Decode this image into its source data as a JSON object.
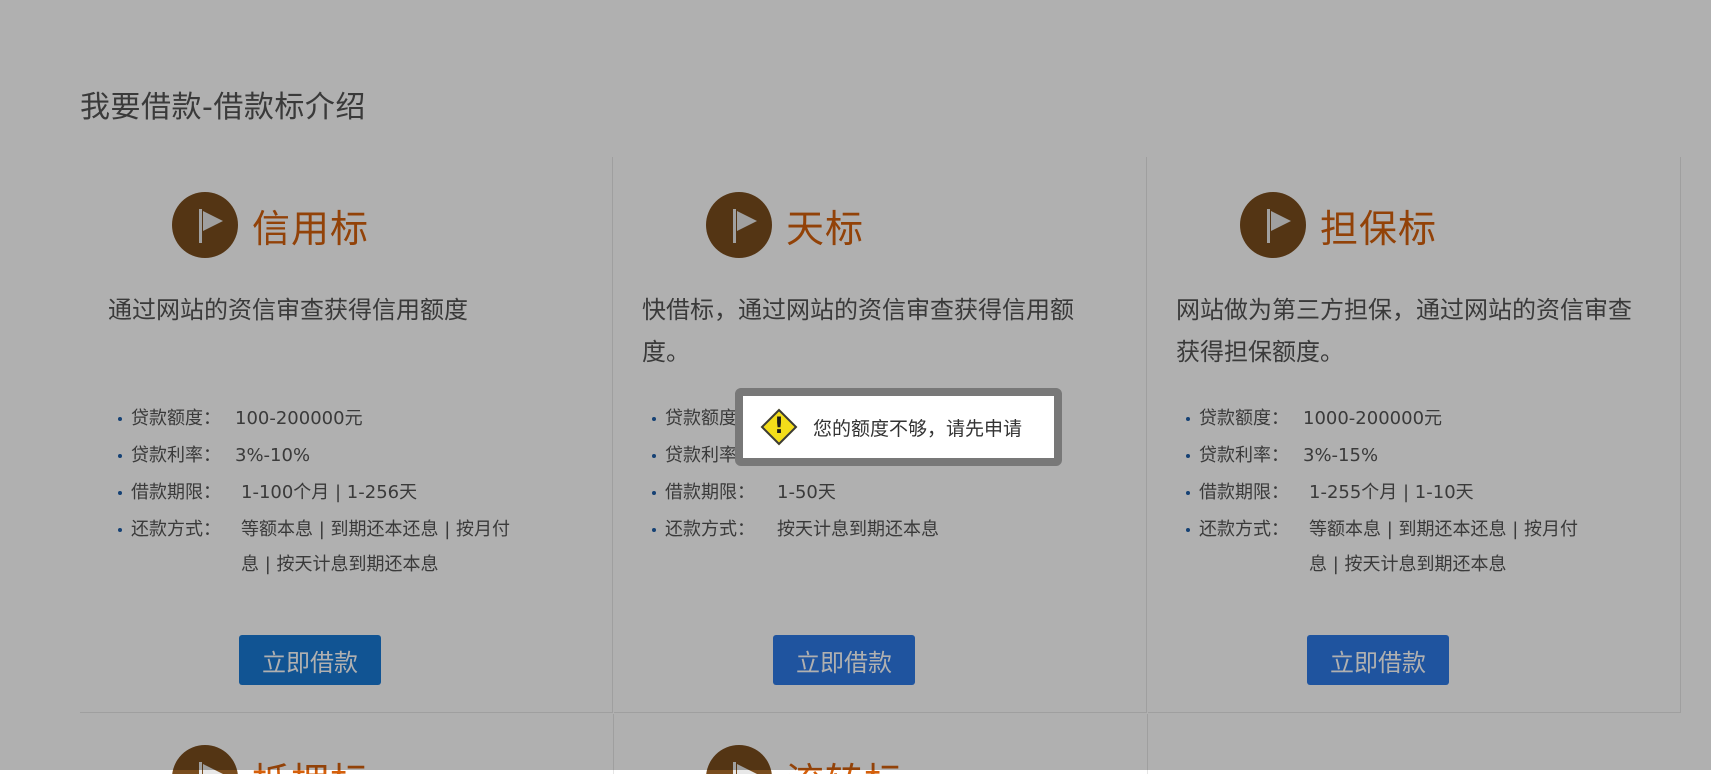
{
  "page_title": "我要借款-借款标介绍",
  "cards": [
    {
      "title": "信用标",
      "desc": "通过网站的资信审查获得信用额度",
      "specs": [
        {
          "label": "贷款额度：",
          "value": "100-200000元"
        },
        {
          "label": "贷款利率：",
          "value": "3%-10%"
        },
        {
          "label": "借款期限：",
          "value": "1-100个月 | 1-256天"
        },
        {
          "label": "还款方式：",
          "value": "等额本息 | 到期还本还息 | 按月付息 | 按天计息到期还本息"
        }
      ],
      "button": "立即借款"
    },
    {
      "title": "天标",
      "desc": "快借标，通过网站的资信审查获得信用额度。",
      "specs": [
        {
          "label": "贷款额度：",
          "value": ""
        },
        {
          "label": "贷款利率：",
          "value": ""
        },
        {
          "label": "借款期限：",
          "value": "1-50天"
        },
        {
          "label": "还款方式：",
          "value": "按天计息到期还本息"
        }
      ],
      "button": "立即借款"
    },
    {
      "title": "担保标",
      "desc": "网站做为第三方担保，通过网站的资信审查获得担保额度。",
      "specs": [
        {
          "label": "贷款额度：",
          "value": "1000-200000元"
        },
        {
          "label": "贷款利率：",
          "value": "3%-15%"
        },
        {
          "label": "借款期限：",
          "value": "1-255个月 | 1-10天"
        },
        {
          "label": "还款方式：",
          "value": "等额本息 | 到期还本还息 | 按月付息 | 按天计息到期还本息"
        }
      ],
      "button": "立即借款"
    }
  ],
  "next_row": [
    {
      "title": "抵押标"
    },
    {
      "title": "流转标"
    }
  ],
  "dialog": {
    "icon": "warning-icon",
    "mark": "!",
    "message": "您的额度不够，请先申请"
  },
  "colors": {
    "accent_title": "#d4600c",
    "button": "#2e7ae6",
    "icon_bg": "#7a4d1e",
    "overlay": "rgba(0,0,0,0.31)"
  }
}
